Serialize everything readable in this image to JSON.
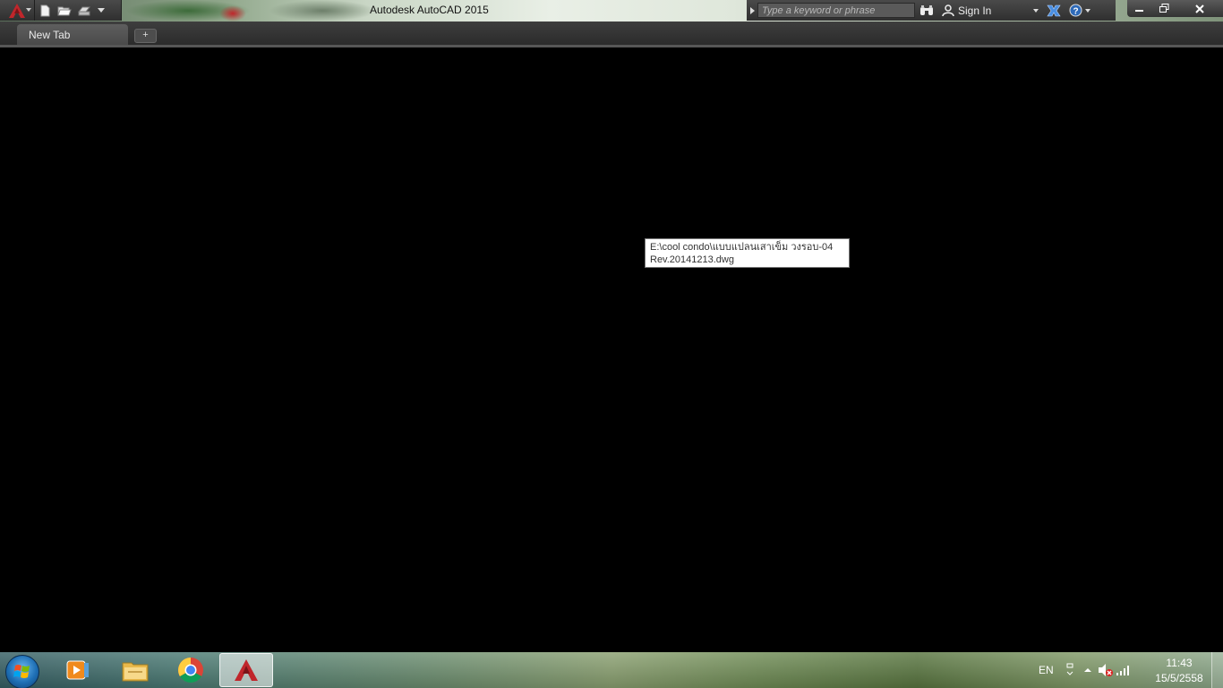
{
  "window": {
    "title": "Autodesk AutoCAD 2015",
    "accent_color": "#c0262b"
  },
  "quick_access": {
    "items": [
      "new-icon",
      "open-icon",
      "plot-icon",
      "customize-dropdown"
    ]
  },
  "search": {
    "placeholder": "Type a keyword or phrase"
  },
  "account": {
    "signin_label": "Sign In"
  },
  "tabs": {
    "active_label": "New Tab",
    "new_tab_glyph": "+"
  },
  "tooltip": {
    "line1": "E:\\cool condo\\แบบแปลนเสาเข็ม วงรอบ-04",
    "line2": "Rev.20141213.dwg"
  },
  "taskbar": {
    "apps": [
      "windows-media-player",
      "windows-explorer",
      "google-chrome",
      "autocad"
    ],
    "active_app": "autocad"
  },
  "tray": {
    "language": "EN",
    "time": "11:43",
    "date": "15/5/2558"
  }
}
